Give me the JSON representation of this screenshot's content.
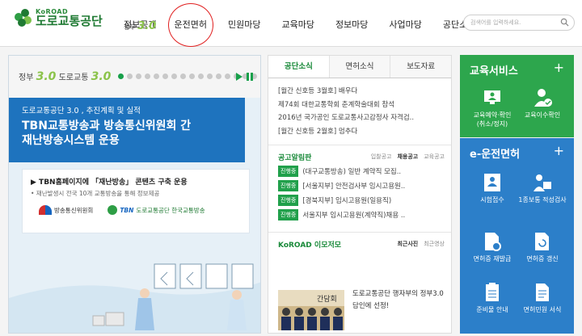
{
  "header": {
    "logo_en": "KoROAD",
    "logo_ko": "도로교통공단",
    "gov_small": "정부",
    "gov_num": "3.0",
    "search_placeholder": "검색어를 입력하세요.",
    "nav": [
      "정보공개",
      "운전면허",
      "민원마당",
      "교육마당",
      "정보마당",
      "사업마당",
      "공단소개"
    ]
  },
  "banner": {
    "brand_gov": "정부",
    "brand_num": "3.0",
    "brand_org": "도로교통",
    "brand_num2": "3.0",
    "subtitle": "도로교통공단 3.0 , 추진계획 및 실적",
    "headline1": "TBN교통방송과 방송통신위원회 간",
    "headline2": "재난방송시스템 운용",
    "card_title": "▶ TBN홈페이지에 「재난방송」 콘텐츠 구축 운용",
    "card_note": "• 재난발생시 전국 10개 교통방송을 통해 정보제공",
    "org1": "방송통신위원회",
    "org2_tag": "TBN",
    "org2": "도로교통공단 한국교통방송"
  },
  "notice": {
    "tabs": [
      "공단소식",
      "면허소식",
      "보도자료"
    ],
    "news": [
      "[월간 신호등 3월호] 배우다",
      "제74회 대한교통학회 춘계학술대회 참석",
      "2016년 국가공인 도로교통사고감정사 자격검..",
      "[월간 신호등 2월호] 멈추다"
    ],
    "jobs_title": "공고알림판",
    "jobs_links": [
      "입찰공고",
      "채용공고",
      "교육공고"
    ],
    "jobs": [
      {
        "badge": "진행중",
        "text": "(대구교통방송) 일반 계약직 모집.."
      },
      {
        "badge": "진행중",
        "text": "[서울지부] 안전검사부 임시고용원.."
      },
      {
        "badge": "진행중",
        "text": "[경북지부] 임시고용원(일용직)"
      },
      {
        "badge": "진행중",
        "text": "서울지부 임시고용원(계약직)채용 .."
      }
    ],
    "blog_title": "KoROAD 이모저모",
    "blog_links": [
      "최근사진",
      "최근영상"
    ],
    "photo_text": "간담회",
    "photo_desc": "도로교통공단 행자부의 정부3.0 담인에 선정!"
  },
  "edu": {
    "title": "교육서비스",
    "plus": "+",
    "items": [
      {
        "label": "교육예약·확인",
        "sub": "(취소/정지)"
      },
      {
        "label": "교육이수확인"
      }
    ]
  },
  "license": {
    "title": "e-운전면허",
    "plus": "+",
    "items": [
      "시험접수",
      "1종보통 적성검사",
      "면허증 재발급",
      "면허증 갱신",
      "준비물 안내",
      "면허민원 서식"
    ]
  },
  "colors": {
    "green": "#2da64d",
    "blue": "#2c7fc9",
    "brand_green": "#1f7a33",
    "banner_blue": "#1e73be"
  }
}
